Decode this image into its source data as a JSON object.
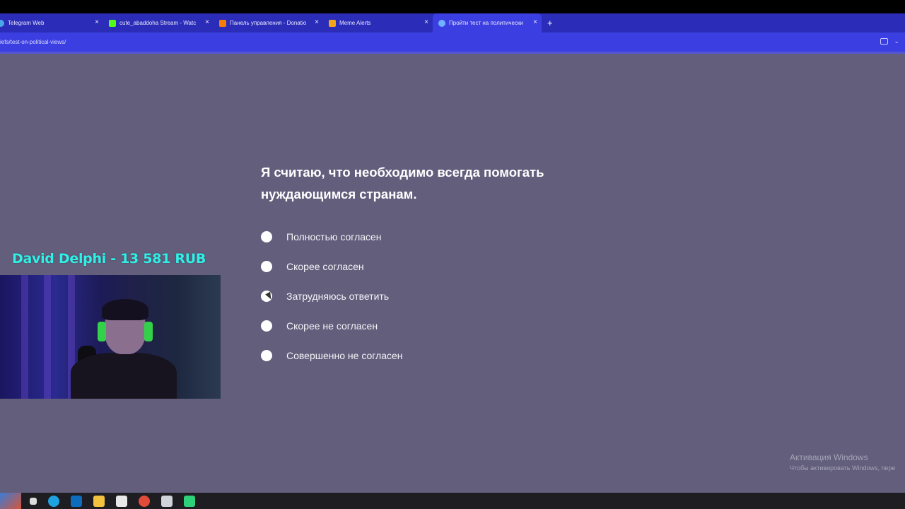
{
  "browser": {
    "tabs": [
      {
        "title": "Telegram Web",
        "icon": "telegram-icon",
        "color": "#4aa7e8",
        "active": false
      },
      {
        "title": "cute_abaddoha Stream - Watch",
        "icon": "kick-icon",
        "color": "#53fc18",
        "active": false
      },
      {
        "title": "Панель управления - Donatio",
        "icon": "donationalerts-icon",
        "color": "#f57d07",
        "active": false
      },
      {
        "title": "Meme Alerts",
        "icon": "meme-alerts-icon",
        "color": "#f2a51a",
        "active": false
      },
      {
        "title": "Пройти тест на политически",
        "icon": "site-icon",
        "color": "#6fb3ff",
        "active": true
      }
    ],
    "close_glyph": "×",
    "new_tab_glyph": "+",
    "url": "iefs/test-on-political-views/"
  },
  "quiz": {
    "question": "Я считаю, что необходимо всегда помогать нуждающимся странам.",
    "options": [
      "Полностью согласен",
      "Скорее согласен",
      "Затрудняюсь ответить",
      "Скорее не согласен",
      "Совершенно не согласен"
    ]
  },
  "stream_overlay": {
    "donation_text": "David Delphi - 13 581 RUB"
  },
  "watermark": {
    "title": "Активация Windows",
    "subtitle": "Чтобы активировать Windows, пере"
  },
  "taskbar": {
    "items": [
      {
        "icon": "task-view-icon",
        "color": "#dcdcdc"
      },
      {
        "icon": "edge-icon",
        "color": "#1fa2e0"
      },
      {
        "icon": "outlook-icon",
        "color": "#0f6cbd"
      },
      {
        "icon": "file-explorer-icon",
        "color": "#f3c33f"
      },
      {
        "icon": "store-icon",
        "color": "#e8e8e8"
      },
      {
        "icon": "chrome-icon",
        "color": "#e14c3a"
      },
      {
        "icon": "photos-icon",
        "color": "#cfd4da"
      },
      {
        "icon": "app-icon",
        "color": "#2fd07a"
      }
    ]
  }
}
